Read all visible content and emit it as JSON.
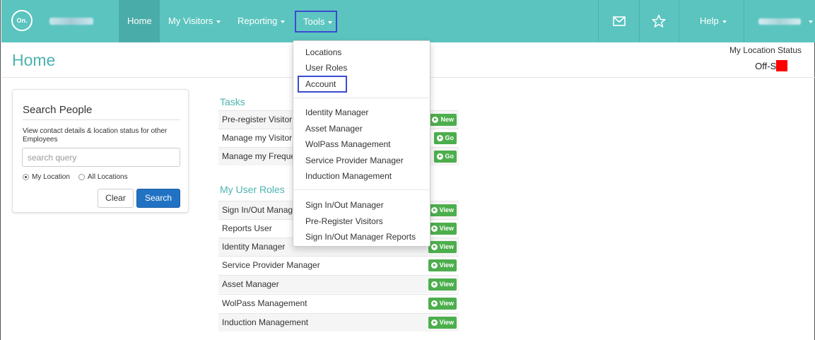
{
  "navbar": {
    "logo_text": "On.",
    "items": [
      {
        "label": "Home",
        "active": true
      },
      {
        "label": "My Visitors",
        "dropdown": true
      },
      {
        "label": "Reporting",
        "dropdown": true
      },
      {
        "label": "Tools",
        "dropdown": true,
        "highlighted": true
      }
    ],
    "icons": [
      "envelope-icon",
      "star-icon"
    ],
    "help_label": "Help"
  },
  "header": {
    "title": "Home",
    "location_status_label": "My Location Status",
    "location_status_value": "Off-Site",
    "status_color": "#ff0000"
  },
  "search_panel": {
    "title": "Search People",
    "description": "View contact details & location status for other Employees",
    "placeholder": "search query",
    "radio_options": [
      {
        "label": "My Location",
        "checked": true
      },
      {
        "label": "All Locations",
        "checked": false
      }
    ],
    "clear_label": "Clear",
    "search_label": "Search"
  },
  "tasks": {
    "title": "Tasks",
    "rows": [
      {
        "label": "Pre-register Visitor",
        "button": "New"
      },
      {
        "label": "Manage my Visitor",
        "button": "Go"
      },
      {
        "label": "Manage my Freque",
        "button": "Go"
      }
    ]
  },
  "user_roles": {
    "title": "My User Roles",
    "rows": [
      {
        "label": "Sign In/Out Manag",
        "button": "View"
      },
      {
        "label": "Reports User",
        "button": "View"
      },
      {
        "label": "Identity Manager",
        "button": "View"
      },
      {
        "label": "Service Provider Manager",
        "button": "View"
      },
      {
        "label": "Asset Manager",
        "button": "View"
      },
      {
        "label": "WolPass Management",
        "button": "View"
      },
      {
        "label": "Induction Management",
        "button": "View"
      }
    ]
  },
  "tools_menu": {
    "groups": [
      [
        "Locations",
        "User Roles",
        "Account"
      ],
      [
        "Identity Manager",
        "Asset Manager",
        "WolPass Management",
        "Service Provider Manager",
        "Induction Management"
      ],
      [
        "Sign In/Out Manager",
        "Pre-Register Visitors",
        "Sign In/Out Manager Reports"
      ]
    ],
    "highlighted_item": "Account"
  },
  "colors": {
    "navbar": "#5bc4bf",
    "accent": "#4bb3b0",
    "highlight_border": "#3a4bd0",
    "primary_button": "#2272c3",
    "success_button": "#4cae4c"
  }
}
